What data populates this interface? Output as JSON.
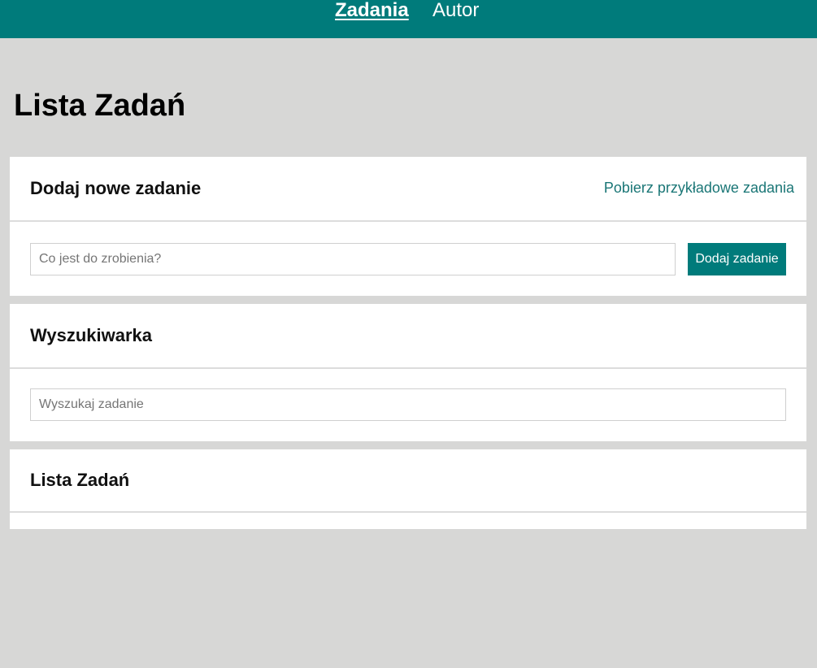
{
  "nav": {
    "items": [
      {
        "label": "Zadania",
        "active": true
      },
      {
        "label": "Autor",
        "active": false
      }
    ]
  },
  "page": {
    "title": "Lista Zadań"
  },
  "add_task": {
    "title": "Dodaj nowe zadanie",
    "sample_link": "Pobierz przykładowe zadania",
    "input_placeholder": "Co jest do zrobienia?",
    "input_value": "",
    "button_label": "Dodaj zadanie"
  },
  "search": {
    "title": "Wyszukiwarka",
    "input_placeholder": "Wyszukaj zadanie",
    "input_value": ""
  },
  "task_list": {
    "title": "Lista Zadań",
    "items": []
  },
  "colors": {
    "primary": "#007b7b",
    "link": "#1a7676",
    "background": "#d7d7d6",
    "card": "#ffffff"
  }
}
